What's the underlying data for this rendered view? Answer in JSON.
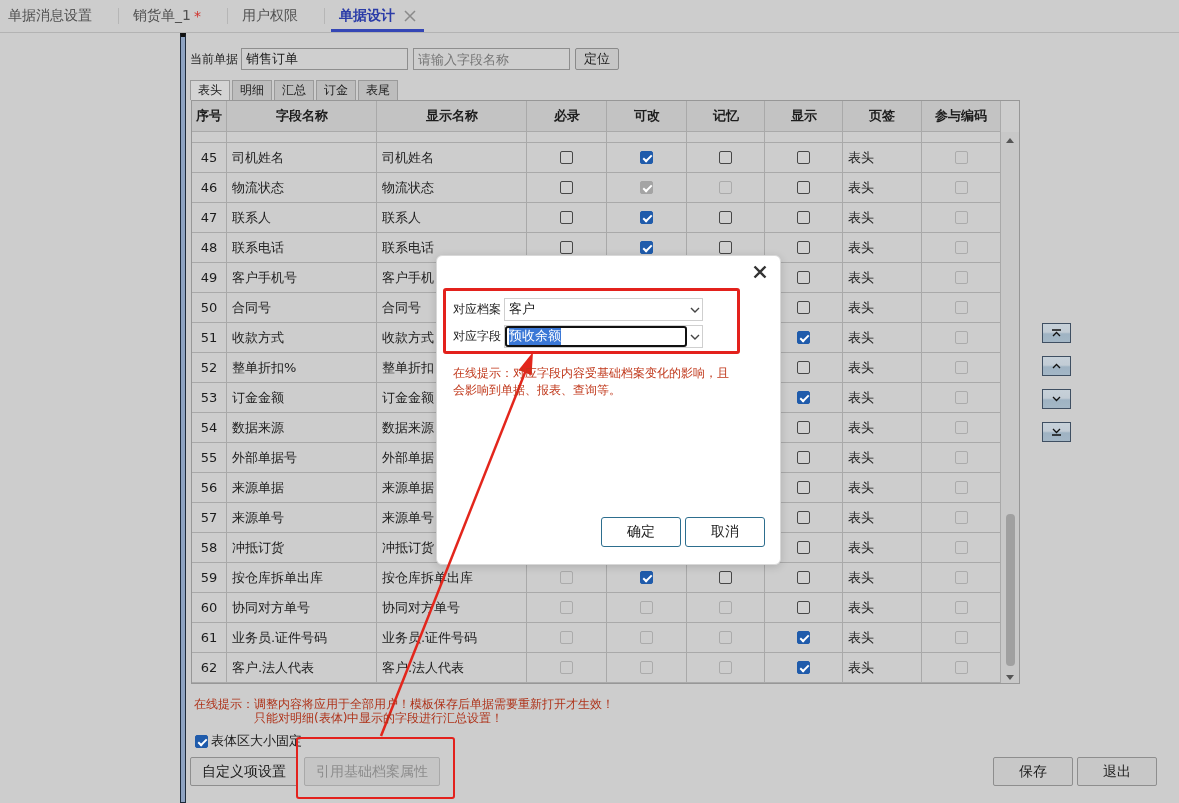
{
  "tabs": [
    {
      "label": "单据消息设置",
      "selected": false,
      "closable": false
    },
    {
      "label": "销货单_1",
      "mark": "*",
      "selected": false,
      "closable": false
    },
    {
      "label": "用户权限",
      "selected": false,
      "closable": false
    },
    {
      "label": "单据设计",
      "selected": true,
      "closable": true
    }
  ],
  "toolbar": {
    "label": "当前单据",
    "document": "销售订单",
    "search": {
      "placeholder": "请输入字段名称"
    },
    "locate_button": "定位"
  },
  "sub_tabs": [
    {
      "label": "表头",
      "selected": true
    },
    {
      "label": "明细",
      "selected": false
    },
    {
      "label": "汇总",
      "selected": false
    },
    {
      "label": "订金",
      "selected": false
    },
    {
      "label": "表尾",
      "selected": false
    }
  ],
  "table": {
    "columns": [
      "序号",
      "字段名称",
      "显示名称",
      "必录",
      "可改",
      "记忆",
      "显示",
      "页签",
      "参与编码"
    ],
    "rows": [
      {
        "no": "45",
        "field": "司机姓名",
        "display": "司机姓名",
        "required": {
          "checked": false,
          "disabled": false
        },
        "editable": {
          "checked": true,
          "disabled": false
        },
        "memory": {
          "checked": false,
          "disabled": false
        },
        "visible": {
          "checked": false,
          "disabled": false
        },
        "tab": "表头",
        "coding": {
          "checked": false,
          "disabled": true
        }
      },
      {
        "no": "46",
        "field": "物流状态",
        "display": "物流状态",
        "required": {
          "checked": false,
          "disabled": false
        },
        "editable": {
          "checked": true,
          "disabled": true
        },
        "memory": {
          "checked": false,
          "disabled": true
        },
        "visible": {
          "checked": false,
          "disabled": false
        },
        "tab": "表头",
        "coding": {
          "checked": false,
          "disabled": true
        }
      },
      {
        "no": "47",
        "field": "联系人",
        "display": "联系人",
        "required": {
          "checked": false,
          "disabled": false
        },
        "editable": {
          "checked": true,
          "disabled": false
        },
        "memory": {
          "checked": false,
          "disabled": false
        },
        "visible": {
          "checked": false,
          "disabled": false
        },
        "tab": "表头",
        "coding": {
          "checked": false,
          "disabled": true
        }
      },
      {
        "no": "48",
        "field": "联系电话",
        "display": "联系电话",
        "required": {
          "checked": false,
          "disabled": false
        },
        "editable": {
          "checked": true,
          "disabled": false
        },
        "memory": {
          "checked": false,
          "disabled": false
        },
        "visible": {
          "checked": false,
          "disabled": false
        },
        "tab": "表头",
        "coding": {
          "checked": false,
          "disabled": true
        }
      },
      {
        "no": "49",
        "field": "客户手机号",
        "display": "客户手机",
        "visible": {
          "checked": false,
          "disabled": false
        },
        "tab": "表头",
        "coding": {
          "checked": false,
          "disabled": true
        }
      },
      {
        "no": "50",
        "field": "合同号",
        "display": "合同号",
        "visible": {
          "checked": false,
          "disabled": false
        },
        "tab": "表头",
        "coding": {
          "checked": false,
          "disabled": true
        }
      },
      {
        "no": "51",
        "field": "收款方式",
        "display": "收款方式",
        "visible": {
          "checked": true,
          "disabled": false
        },
        "tab": "表头",
        "coding": {
          "checked": false,
          "disabled": true
        }
      },
      {
        "no": "52",
        "field": "整单折扣%",
        "display": "整单折扣",
        "visible": {
          "checked": false,
          "disabled": false
        },
        "tab": "表头",
        "coding": {
          "checked": false,
          "disabled": true
        }
      },
      {
        "no": "53",
        "field": "订金金额",
        "display": "订金金额",
        "visible": {
          "checked": true,
          "disabled": false
        },
        "tab": "表头",
        "coding": {
          "checked": false,
          "disabled": true
        }
      },
      {
        "no": "54",
        "field": "数据来源",
        "display": "数据来源",
        "visible": {
          "checked": false,
          "disabled": false
        },
        "tab": "表头",
        "coding": {
          "checked": false,
          "disabled": true
        }
      },
      {
        "no": "55",
        "field": "外部单据号",
        "display": "外部单据",
        "visible": {
          "checked": false,
          "disabled": false
        },
        "tab": "表头",
        "coding": {
          "checked": false,
          "disabled": true
        }
      },
      {
        "no": "56",
        "field": "来源单据",
        "display": "来源单据",
        "visible": {
          "checked": false,
          "disabled": false
        },
        "tab": "表头",
        "coding": {
          "checked": false,
          "disabled": true
        }
      },
      {
        "no": "57",
        "field": "来源单号",
        "display": "来源单号",
        "visible": {
          "checked": false,
          "disabled": false
        },
        "tab": "表头",
        "coding": {
          "checked": false,
          "disabled": true
        }
      },
      {
        "no": "58",
        "field": "冲抵订货",
        "display": "冲抵订货",
        "visible": {
          "checked": false,
          "disabled": false
        },
        "tab": "表头",
        "coding": {
          "checked": false,
          "disabled": true
        }
      },
      {
        "no": "59",
        "field": "按仓库拆单出库",
        "display": "按仓库拆单出库",
        "required": {
          "checked": false,
          "disabled": true
        },
        "editable": {
          "checked": true,
          "disabled": false
        },
        "memory": {
          "checked": false,
          "disabled": false
        },
        "visible": {
          "checked": false,
          "disabled": false
        },
        "tab": "表头",
        "coding": {
          "checked": false,
          "disabled": true
        }
      },
      {
        "no": "60",
        "field": "协同对方单号",
        "display": "协同对方单号",
        "required": {
          "checked": false,
          "disabled": true
        },
        "editable": {
          "checked": false,
          "disabled": true
        },
        "memory": {
          "checked": false,
          "disabled": true
        },
        "visible": {
          "checked": false,
          "disabled": false
        },
        "tab": "表头",
        "coding": {
          "checked": false,
          "disabled": true
        }
      },
      {
        "no": "61",
        "field": "业务员.证件号码",
        "display": "业务员.证件号码",
        "required": {
          "checked": false,
          "disabled": true
        },
        "editable": {
          "checked": false,
          "disabled": true
        },
        "memory": {
          "checked": false,
          "disabled": true
        },
        "visible": {
          "checked": true,
          "disabled": false
        },
        "tab": "表头",
        "coding": {
          "checked": false,
          "disabled": true
        }
      },
      {
        "no": "62",
        "field": "客户.法人代表",
        "display": "客户.法人代表",
        "required": {
          "checked": false,
          "disabled": true
        },
        "editable": {
          "checked": false,
          "disabled": true
        },
        "memory": {
          "checked": false,
          "disabled": true
        },
        "visible": {
          "checked": true,
          "disabled": false
        },
        "tab": "表头",
        "coding": {
          "checked": false,
          "disabled": true
        }
      }
    ]
  },
  "footer": {
    "hints": [
      "在线提示：调整内容将应用于全部用户！模板保存后单据需要重新打开才生效！",
      "只能对明细(表体)中显示的字段进行汇总设置！"
    ],
    "fixed_size": {
      "label": "表体区大小固定",
      "checked": true
    },
    "left_buttons": [
      {
        "label": "自定义项设置",
        "disabled": false
      },
      {
        "label": "引用基础档案属性",
        "disabled": true
      }
    ],
    "right_buttons": [
      {
        "label": "保存",
        "disabled": false
      },
      {
        "label": "退出",
        "disabled": false
      }
    ]
  },
  "dialog": {
    "fields": [
      {
        "label": "对应档案",
        "value": "客户",
        "focused": false
      },
      {
        "label": "对应字段",
        "value": "预收余额",
        "focused": true
      }
    ],
    "hint": "在线提示：对应字段内容受基础档案变化的影响，且会影响到单据、报表、查询等。",
    "buttons": [
      "确定",
      "取消"
    ]
  }
}
